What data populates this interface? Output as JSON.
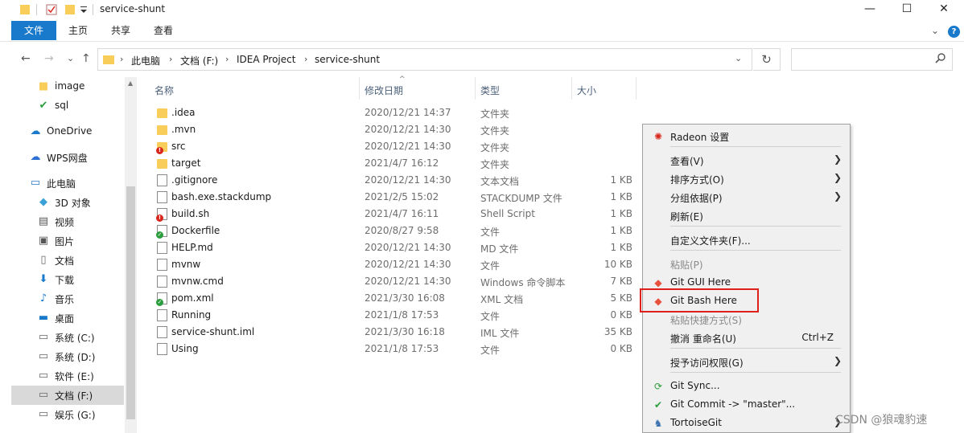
{
  "window": {
    "title": "service-shunt",
    "controls": {
      "minimize": "—",
      "maximize": "☐",
      "close": "✕"
    }
  },
  "ribbon": {
    "tabs": [
      {
        "label": "文件",
        "active": true
      },
      {
        "label": "主页",
        "active": false
      },
      {
        "label": "共享",
        "active": false
      },
      {
        "label": "查看",
        "active": false
      }
    ],
    "collapse_glyph": "⌄",
    "help_glyph": "?"
  },
  "nav": {
    "back": "←",
    "forward": "→",
    "recent": "⌄",
    "up": "↑",
    "breadcrumb": [
      "此电脑",
      "文档 (F:)",
      "IDEA Project",
      "service-shunt"
    ],
    "crumb_separator": "›",
    "dropdown": "⌄",
    "refresh": "↻",
    "search_placeholder": "",
    "search_icon": "⚲"
  },
  "sidebar": {
    "items": [
      {
        "label": "image",
        "icon": "folder-icon"
      },
      {
        "label": "sql",
        "icon": "folder-sync-icon"
      },
      {
        "label": "OneDrive",
        "icon": "cloud-icon"
      },
      {
        "label": "WPS网盘",
        "icon": "wps-cloud-icon"
      },
      {
        "label": "此电脑",
        "icon": "computer-icon"
      },
      {
        "label": "3D 对象",
        "icon": "cube-icon"
      },
      {
        "label": "视频",
        "icon": "video-icon"
      },
      {
        "label": "图片",
        "icon": "picture-icon"
      },
      {
        "label": "文档",
        "icon": "document-icon"
      },
      {
        "label": "下载",
        "icon": "download-icon"
      },
      {
        "label": "音乐",
        "icon": "music-icon"
      },
      {
        "label": "桌面",
        "icon": "desktop-icon"
      },
      {
        "label": "系统 (C:)",
        "icon": "drive-icon"
      },
      {
        "label": "系统 (D:)",
        "icon": "drive-icon"
      },
      {
        "label": "软件 (E:)",
        "icon": "drive-icon"
      },
      {
        "label": "文档 (F:)",
        "icon": "drive-icon",
        "selected": true
      },
      {
        "label": "娱乐 (G:)",
        "icon": "drive-icon"
      }
    ]
  },
  "filelist": {
    "columns": {
      "name": "名称",
      "date": "修改日期",
      "type": "类型",
      "size": "大小"
    },
    "sort_indicator": "^",
    "rows": [
      {
        "name": ".idea",
        "date": "2020/12/21 14:37",
        "type": "文件夹",
        "size": "",
        "icon": "folder",
        "badge": ""
      },
      {
        "name": ".mvn",
        "date": "2020/12/21 14:30",
        "type": "文件夹",
        "size": "",
        "icon": "folder",
        "badge": ""
      },
      {
        "name": "src",
        "date": "2020/12/21 14:30",
        "type": "文件夹",
        "size": "",
        "icon": "folder",
        "badge": "red"
      },
      {
        "name": "target",
        "date": "2021/4/7 16:12",
        "type": "文件夹",
        "size": "",
        "icon": "folder",
        "badge": ""
      },
      {
        "name": ".gitignore",
        "date": "2020/12/21 14:30",
        "type": "文本文档",
        "size": "1 KB",
        "icon": "doc",
        "badge": ""
      },
      {
        "name": "bash.exe.stackdump",
        "date": "2021/2/5 15:02",
        "type": "STACKDUMP 文件",
        "size": "1 KB",
        "icon": "doc",
        "badge": ""
      },
      {
        "name": "build.sh",
        "date": "2021/4/7 16:11",
        "type": "Shell Script",
        "size": "1 KB",
        "icon": "doc",
        "badge": "red"
      },
      {
        "name": "Dockerfile",
        "date": "2020/8/27 9:58",
        "type": "文件",
        "size": "1 KB",
        "icon": "doc",
        "badge": "green"
      },
      {
        "name": "HELP.md",
        "date": "2020/12/21 14:30",
        "type": "MD 文件",
        "size": "1 KB",
        "icon": "doc",
        "badge": ""
      },
      {
        "name": "mvnw",
        "date": "2020/12/21 14:30",
        "type": "文件",
        "size": "10 KB",
        "icon": "doc",
        "badge": ""
      },
      {
        "name": "mvnw.cmd",
        "date": "2020/12/21 14:30",
        "type": "Windows 命令脚本",
        "size": "7 KB",
        "icon": "doc",
        "badge": ""
      },
      {
        "name": "pom.xml",
        "date": "2021/3/30 16:08",
        "type": "XML 文档",
        "size": "5 KB",
        "icon": "doc",
        "badge": "green"
      },
      {
        "name": "Running",
        "date": "2021/1/8 17:53",
        "type": "文件",
        "size": "0 KB",
        "icon": "doc",
        "badge": ""
      },
      {
        "name": "service-shunt.iml",
        "date": "2021/3/30 16:18",
        "type": "IML 文件",
        "size": "35 KB",
        "icon": "doc",
        "badge": ""
      },
      {
        "name": "Using",
        "date": "2021/1/8 17:53",
        "type": "文件",
        "size": "0 KB",
        "icon": "doc",
        "badge": ""
      }
    ]
  },
  "context_menu": {
    "items": [
      {
        "label": "Radeon 设置",
        "icon": "radeon-icon",
        "submenu": false,
        "disabled": false,
        "shortcut": ""
      },
      {
        "label": "查看(V)",
        "icon": "",
        "submenu": true,
        "disabled": false,
        "shortcut": ""
      },
      {
        "label": "排序方式(O)",
        "icon": "",
        "submenu": true,
        "disabled": false,
        "shortcut": ""
      },
      {
        "label": "分组依据(P)",
        "icon": "",
        "submenu": true,
        "disabled": false,
        "shortcut": ""
      },
      {
        "label": "刷新(E)",
        "icon": "",
        "submenu": false,
        "disabled": false,
        "shortcut": ""
      },
      {
        "label": "自定义文件夹(F)...",
        "icon": "",
        "submenu": false,
        "disabled": false,
        "shortcut": ""
      },
      {
        "label": "粘贴(P)",
        "icon": "",
        "submenu": false,
        "disabled": true,
        "shortcut": ""
      },
      {
        "label": "Git GUI Here",
        "icon": "git-icon",
        "submenu": false,
        "disabled": false,
        "shortcut": ""
      },
      {
        "label": "Git Bash Here",
        "icon": "git-icon",
        "submenu": false,
        "disabled": false,
        "shortcut": ""
      },
      {
        "label": "粘贴快捷方式(S)",
        "icon": "",
        "submenu": false,
        "disabled": true,
        "shortcut": ""
      },
      {
        "label": "撤消 重命名(U)",
        "icon": "",
        "submenu": false,
        "disabled": false,
        "shortcut": "Ctrl+Z"
      },
      {
        "label": "授予访问权限(G)",
        "icon": "",
        "submenu": true,
        "disabled": false,
        "shortcut": ""
      },
      {
        "label": "Git Sync...",
        "icon": "tortoisegit-sync-icon",
        "submenu": false,
        "disabled": false,
        "shortcut": ""
      },
      {
        "label": "Git Commit -> \"master\"...",
        "icon": "git-commit-icon",
        "submenu": false,
        "disabled": false,
        "shortcut": ""
      },
      {
        "label": "TortoiseGit",
        "icon": "tortoisegit-icon",
        "submenu": true,
        "disabled": false,
        "shortcut": ""
      }
    ],
    "submenu_glyph": "❯",
    "highlighted_item": "Git Bash Here"
  },
  "watermark": "CSDN @狼魂豹速",
  "colors": {
    "accent": "#1979ca",
    "folder": "#f8cd5a",
    "menu_bg": "#f0f0f0",
    "highlight_border": "#e0201d"
  }
}
